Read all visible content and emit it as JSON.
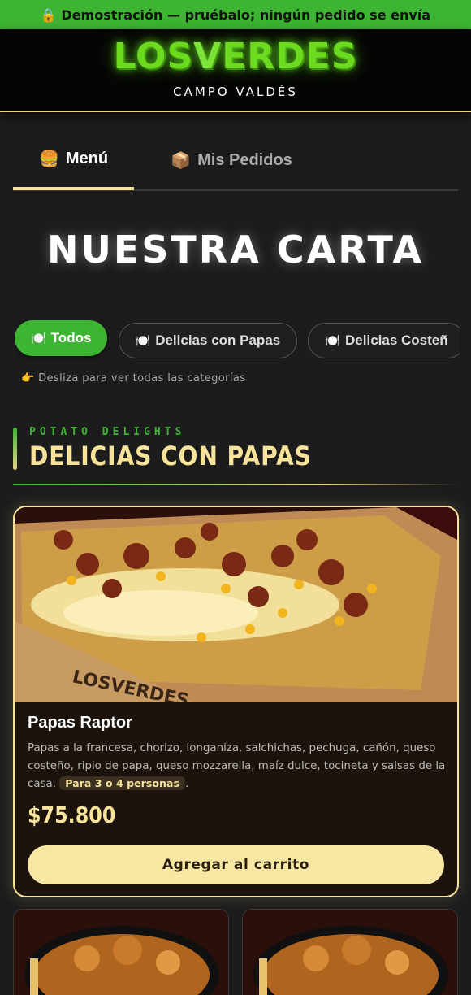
{
  "banner": {
    "text": "🔒 Demostración — pruébalo; ningún pedido se envía"
  },
  "brand": {
    "logo": "LOSVERDES",
    "subtitle": "CAMPO VALDÉS"
  },
  "tabs": [
    {
      "icon": "🍔",
      "label": "Menú",
      "active": true
    },
    {
      "icon": "📦",
      "label": "Mis Pedidos",
      "active": false
    }
  ],
  "page_title": "NUESTRA CARTA",
  "categories": [
    {
      "icon": "🍽️",
      "label": "Todos",
      "active": true
    },
    {
      "icon": "🍽️",
      "label": "Delicias con Papas",
      "active": false
    },
    {
      "icon": "🍽️",
      "label": "Delicias Costeñ",
      "active": false
    }
  ],
  "hint": "👉 Desliza para ver todas las categorías",
  "section": {
    "kicker": "POTATO DELIGHTS",
    "title": "DELICIAS CON PAPAS"
  },
  "product": {
    "name": "Papas Raptor",
    "description": "Papas a la francesa, chorizo, longaniza, salchichas, pechuga, cañón, queso costeño, ripio de papa, queso mozzarella, maíz dulce, tocineta y salsas de la casa.",
    "serving_tag": "Para 3 o 4 personas",
    "price": "$75.800",
    "add_button": "Agregar al carrito"
  },
  "colors": {
    "accent_green": "#3db533",
    "accent_cream": "#f7e39a",
    "background": "#1c1c1c"
  }
}
